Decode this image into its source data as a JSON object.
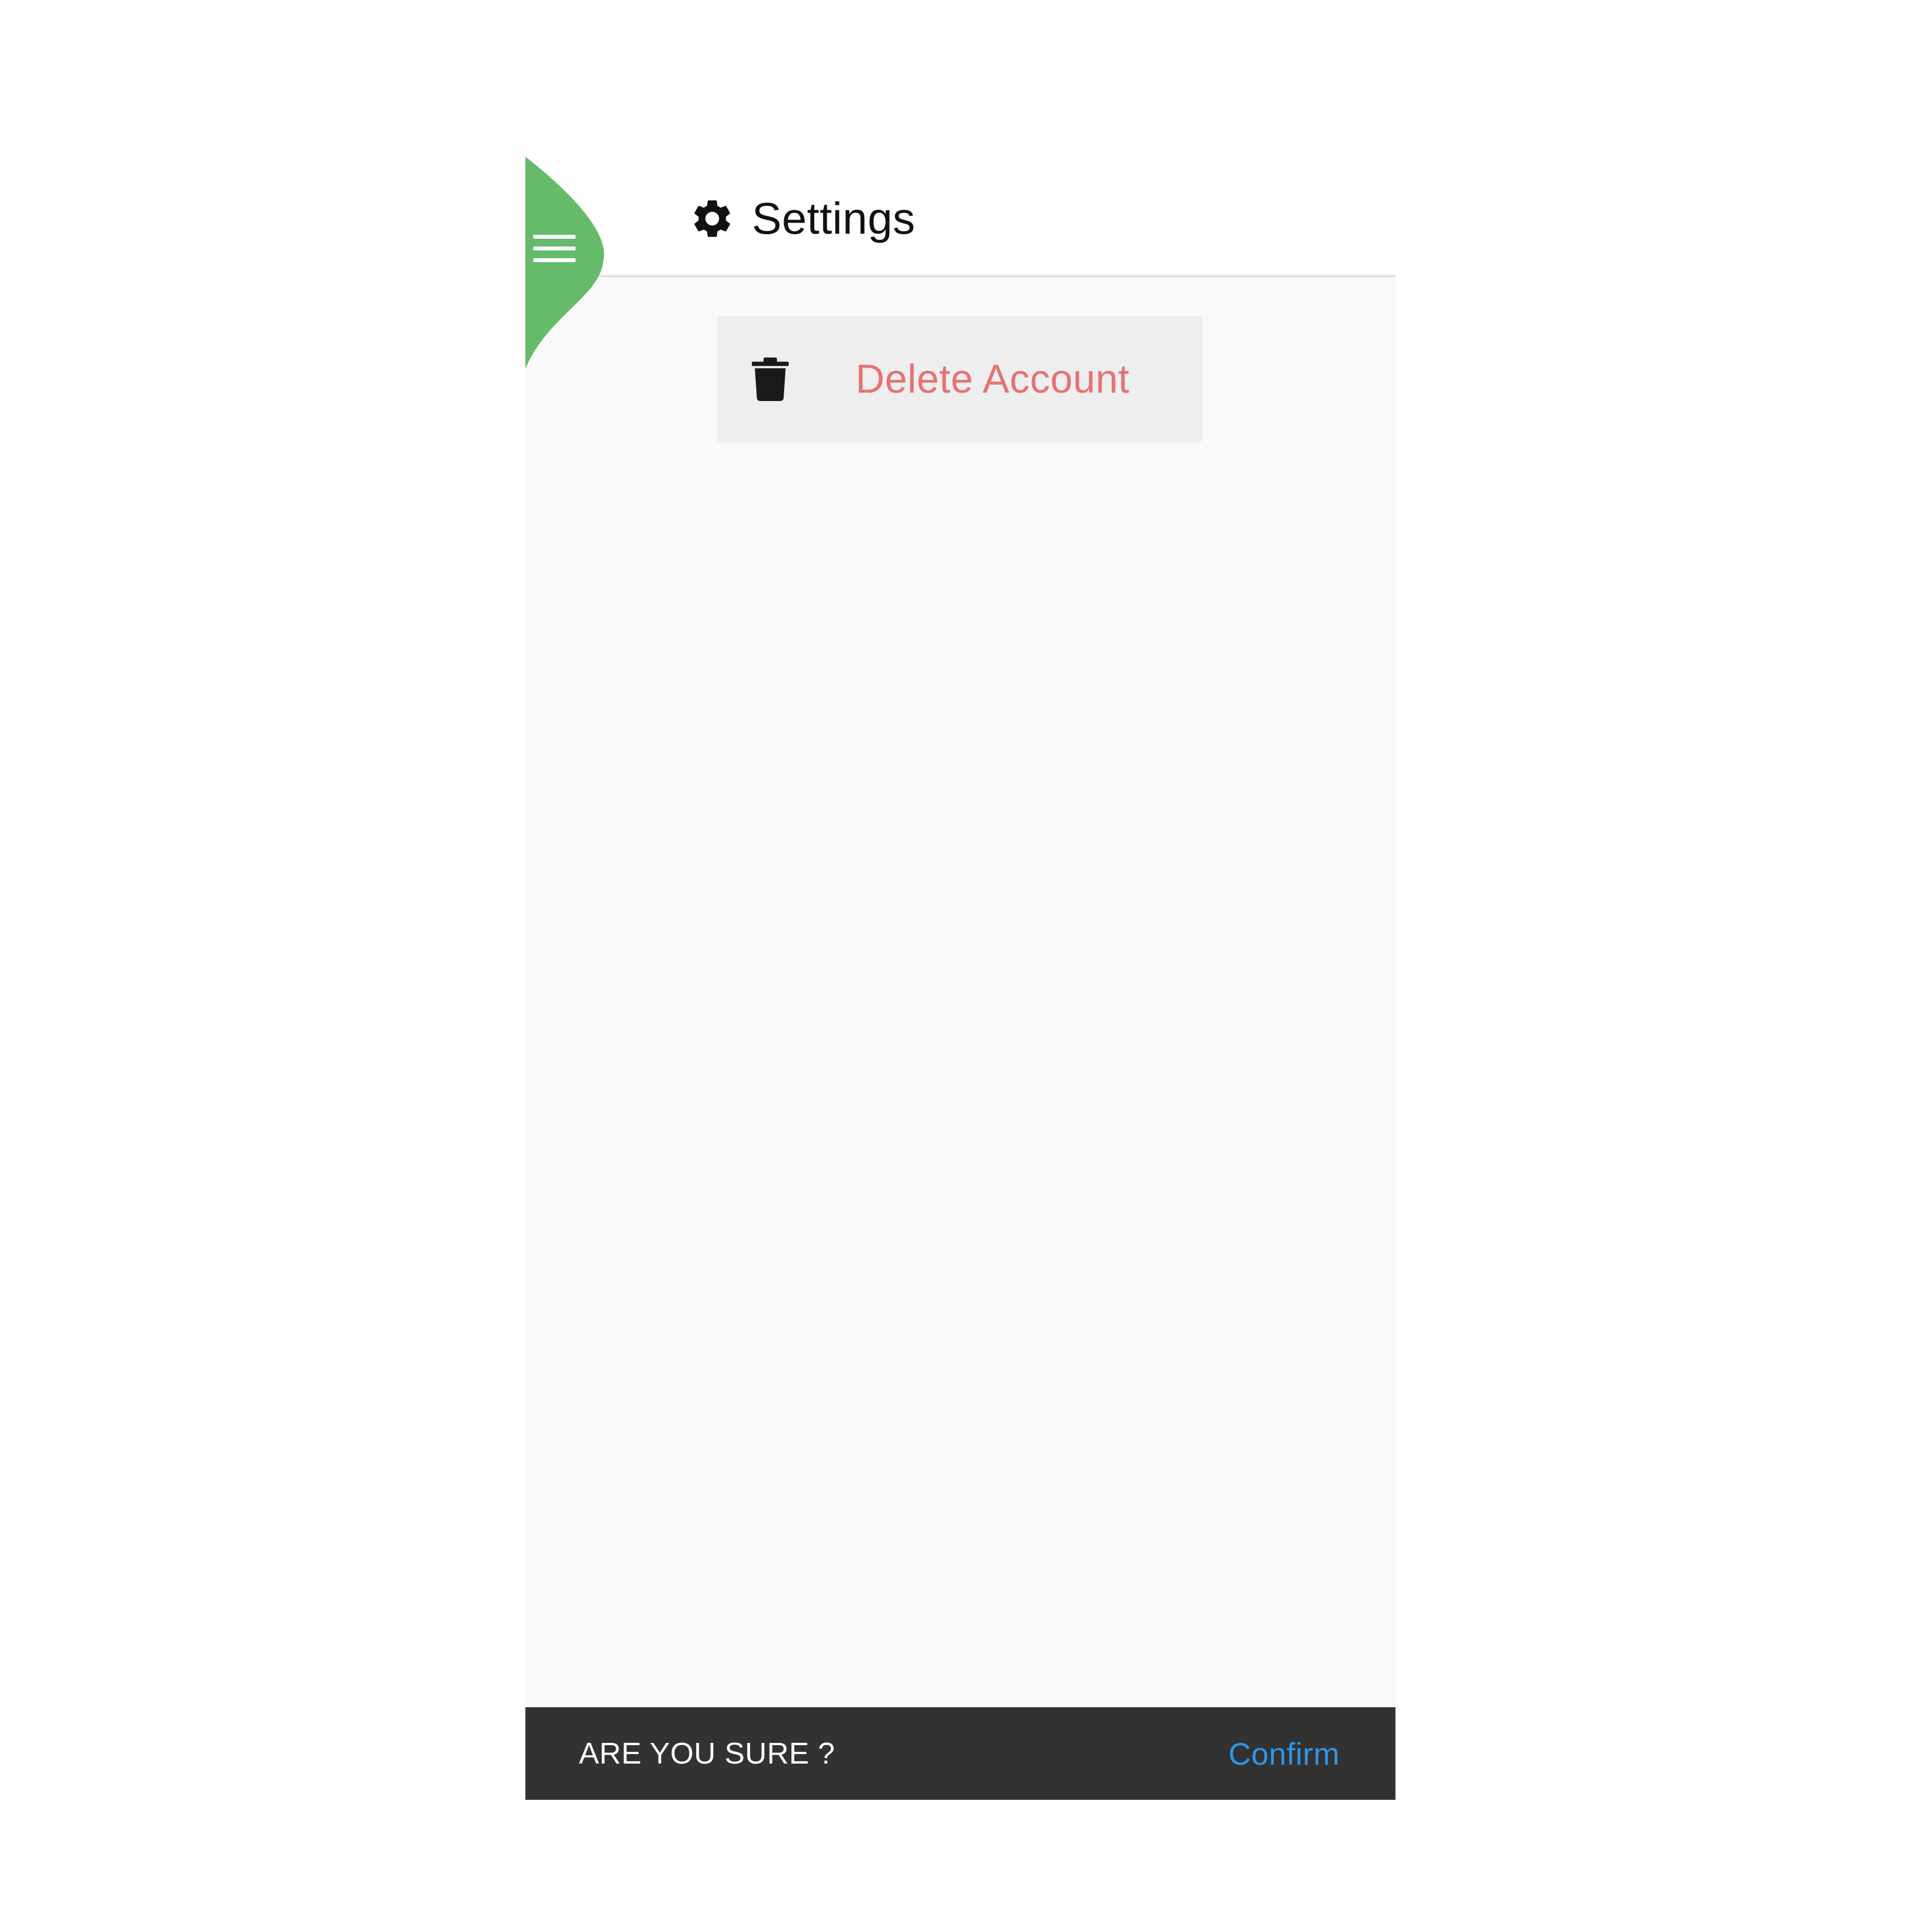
{
  "header": {
    "title": "Settings",
    "title_icon": "gear-icon",
    "menu_icon": "hamburger-menu-icon"
  },
  "actions": {
    "delete_account_label": "Delete Account",
    "delete_icon": "trash-icon"
  },
  "snackbar": {
    "message": "ARE YOU SURE ?",
    "action_label": "Confirm"
  },
  "colors": {
    "drawer_accent": "#66bb6a",
    "danger_text": "#e57373",
    "snackbar_bg": "#323232",
    "snackbar_action": "#2e95e6"
  }
}
